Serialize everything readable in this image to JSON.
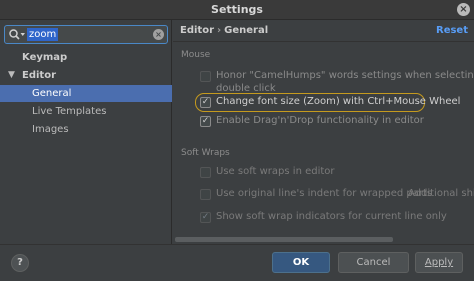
{
  "window": {
    "title": "Settings",
    "close": "×"
  },
  "search": {
    "value": "zoom",
    "clear": "×"
  },
  "tree": {
    "items": [
      {
        "label": "Keymap"
      },
      {
        "label": "Editor",
        "arrow": "▼"
      },
      {
        "label": "General"
      },
      {
        "label": "Live Templates"
      },
      {
        "label": "Images"
      }
    ]
  },
  "header": {
    "crumb1": "Editor",
    "sep": "›",
    "crumb2": "General",
    "reset": "Reset"
  },
  "sections": {
    "mouse": "Mouse",
    "soft_wraps": "Soft Wraps"
  },
  "options": {
    "camelhumps_line1": "Honor \"CamelHumps\" words settings when selecting on",
    "camelhumps_line2": "double click",
    "zoom": "Change font size (Zoom) with Ctrl+Mouse Wheel",
    "dragdrop": "Enable Drag'n'Drop functionality in editor",
    "soft_wraps_editor": "Use soft wraps in editor",
    "original_indent": "Use original line's indent for wrapped parts",
    "additional_shift": "Additional shift",
    "wrap_indicators": "Show soft wrap indicators for current line only"
  },
  "check": "✓",
  "footer": {
    "help": "?",
    "ok": "OK",
    "cancel": "Cancel",
    "apply": "Apply"
  }
}
